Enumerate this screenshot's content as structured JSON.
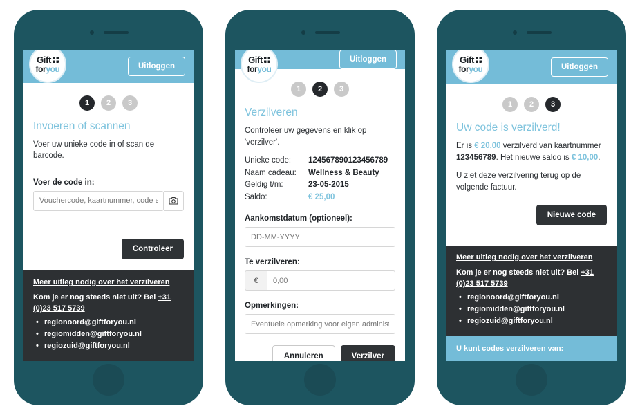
{
  "brand": {
    "logo_line1": "Gift",
    "logo_line2_for": "for",
    "logo_line2_you": "you",
    "logo_icon": "gift-box-icon",
    "header_color": "#74bcd8",
    "frame_color": "#1d5560",
    "footer_color": "#2d3033",
    "accent_color": "#7ec3dd",
    "dark_button_color": "#2f3336"
  },
  "header": {
    "logout_label": "Uitloggen"
  },
  "footer": {
    "heading": "Meer uitleg nodig over het verzilveren",
    "help_prefix": "Kom je er nog steeds niet uit? Bel ",
    "phone": "+31 (0)23 517 5739",
    "emails": [
      "regionoord@giftforyou.nl",
      "regiomidden@giftforyou.nl",
      "regiozuid@giftforyou.nl"
    ]
  },
  "phone1": {
    "steps": [
      "1",
      "2",
      "3"
    ],
    "active_step": 1,
    "title": "Invoeren of scannen",
    "lead": "Voer uw unieke code in of scan de barcode.",
    "field_label": "Voer de code in:",
    "input_placeholder": "Vouchercode, kaartnummer, code e",
    "camera_icon": "camera-icon",
    "submit_label": "Controleer"
  },
  "phone2": {
    "steps": [
      "1",
      "2",
      "3"
    ],
    "active_step": 2,
    "title": "Verzilveren",
    "lead": "Controleer uw gegevens en klik op 'verzilver'.",
    "details": [
      {
        "key": "Unieke code:",
        "value": "124567890123456789",
        "accent": false
      },
      {
        "key": "Naam cadeau:",
        "value": "Wellness & Beauty",
        "accent": false
      },
      {
        "key": "Geldig t/m:",
        "value": "23-05-2015",
        "accent": false
      },
      {
        "key": "Saldo:",
        "value": "€ 25,00",
        "accent": true
      }
    ],
    "date_label": "Aankomstdatum (optioneel):",
    "date_placeholder": "DD-MM-YYYY",
    "amount_label": "Te verzilveren:",
    "amount_prefix": "€",
    "amount_placeholder": "0,00",
    "remarks_label": "Opmerkingen:",
    "remarks_placeholder": "Eventuele opmerking voor eigen administ",
    "cancel_label": "Annuleren",
    "submit_label": "Verzilver"
  },
  "phone3": {
    "steps": [
      "1",
      "2",
      "3"
    ],
    "active_step": 3,
    "title": "Uw code is verzilverd!",
    "body_a": "Er is ",
    "amount_redeemed": "€ 20,00",
    "body_b": " verzilverd van kaartnummer ",
    "card_number": "123456789",
    "body_c": ". Het nieuwe saldo is ",
    "new_balance": "€ 10,00",
    "body_d": ".",
    "body_e": "U ziet deze verzilvering terug op de volgende factuur.",
    "new_code_label": "Nieuwe code",
    "blue_bar_text": "U kunt codes verzilveren van:"
  }
}
